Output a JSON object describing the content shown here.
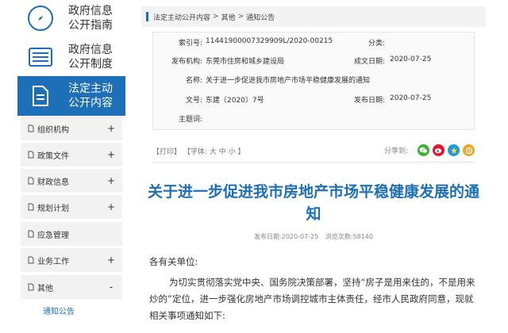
{
  "sidebar": {
    "main_items": [
      {
        "label": "政府信息公开指南",
        "icon": "compass-icon"
      },
      {
        "label": "政府信息公开制度",
        "icon": "list-icon"
      },
      {
        "label": "法定主动公开内容",
        "icon": "document-icon"
      }
    ],
    "sub_items": [
      {
        "label": "组织机构",
        "toggle": "+"
      },
      {
        "label": "政策文件",
        "toggle": "+"
      },
      {
        "label": "财政信息",
        "toggle": "+"
      },
      {
        "label": "规划计划",
        "toggle": "+"
      },
      {
        "label": "应急管理",
        "toggle": ""
      },
      {
        "label": "业务工作",
        "toggle": "+"
      },
      {
        "label": "其他",
        "toggle": "-"
      }
    ],
    "child_item": "通知公告"
  },
  "breadcrumb": {
    "items": [
      "法定主动公开内容",
      "其他",
      "通知公告"
    ],
    "separator": ">"
  },
  "meta": {
    "index_label": "索引号:",
    "index_value": "11441900007329909L/2020-00215",
    "category_label": "分类:",
    "category_value": "",
    "issuer_label": "发布机构:",
    "issuer_value": "东莞市住房和城乡建设局",
    "created_label": "成文日期:",
    "created_value": "2020-07-25",
    "name_label": "名称:",
    "name_value": "关于进一步促进我市房地产市场平稳健康发展的通知",
    "docno_label": "文号:",
    "docno_value": "东建〔2020〕7号",
    "published_label": "发布日期:",
    "published_value": "2020-07-25",
    "subject_label": "主题词:",
    "subject_value": ""
  },
  "tools": {
    "print": "【打印】",
    "font_prefix": "【字体:",
    "font_large": "大",
    "font_medium": "中",
    "font_small": "小",
    "font_suffix": "】",
    "share_label": "分享到:",
    "share_icons": [
      "wechat-icon",
      "weibo-icon",
      "qq-zone-icon",
      "friends-icon"
    ]
  },
  "article": {
    "title": "关于进一步促进我市房地产市场平稳健康发展的通知",
    "publish_date": "发布日期:2020-07-25",
    "views": "浏览次数:58140",
    "salutation": "各有关单位:",
    "paragraph": "为切实贯彻落实党中央、国务院决策部署，坚持“房子是用来住的，不是用来炒的”定位，进一步强化房地产市场调控城市主体责任，经市人民政府同意，现就相关事项通知如下:"
  },
  "colors": {
    "brand": "#1d6fb7",
    "wechat": "#3cb034",
    "weibo": "#e6162d",
    "qq": "#1e9bd7",
    "friends": "#f1a325"
  }
}
